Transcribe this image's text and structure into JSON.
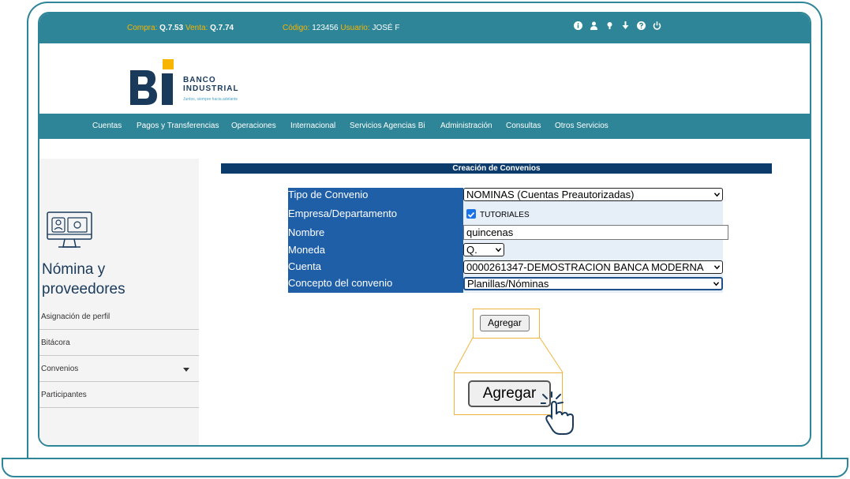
{
  "topbar": {
    "compra_label": "Compra:",
    "compra_value": "Q.7.53",
    "venta_label": "Venta:",
    "venta_value": "Q.7.74",
    "codigo_label": "Código:",
    "codigo_value": "123456",
    "usuario_label": "Usuario:",
    "usuario_value": "JOSÉ F",
    "icons": [
      "info-icon",
      "user-icon",
      "lightbulb-icon",
      "download-icon",
      "help-icon",
      "power-icon"
    ]
  },
  "brand": {
    "name_line1": "BANCO",
    "name_line2": "INDUSTRIAL",
    "tagline": "Juntos, siempre hacia adelante",
    "colors": {
      "primary": "#2e8597",
      "navy": "#1a3a5c",
      "accent": "#f7b500"
    }
  },
  "nav": {
    "items": [
      "Cuentas",
      "Pagos y Transferencias",
      "Operaciones",
      "Internacional",
      "Servicios Agencias Bi",
      "Administración",
      "Consultas",
      "Otros Servicios"
    ]
  },
  "sidebar": {
    "title_line1": "Nómina y",
    "title_line2": "proveedores",
    "items": [
      "Asignación de perfil",
      "Bitácora",
      "Convenios",
      "Participantes"
    ]
  },
  "form": {
    "header": "Creación de Convenios",
    "labels": [
      "Tipo de Convenio",
      "Empresa/Departamento",
      "Nombre",
      "Moneda",
      "Cuenta",
      "Concepto del convenio"
    ],
    "tipo_value": "NOMINAS (Cuentas Preautorizadas)",
    "empresa_value": "TUTORIALES",
    "empresa_checked": true,
    "nombre_value": "quincenas",
    "moneda_value": "Q.",
    "cuenta_value": "0000261347-DEMOSTRACION BANCA MODERNA",
    "concepto_value": "Planillas/Nóminas",
    "submit_label": "Agregar"
  }
}
